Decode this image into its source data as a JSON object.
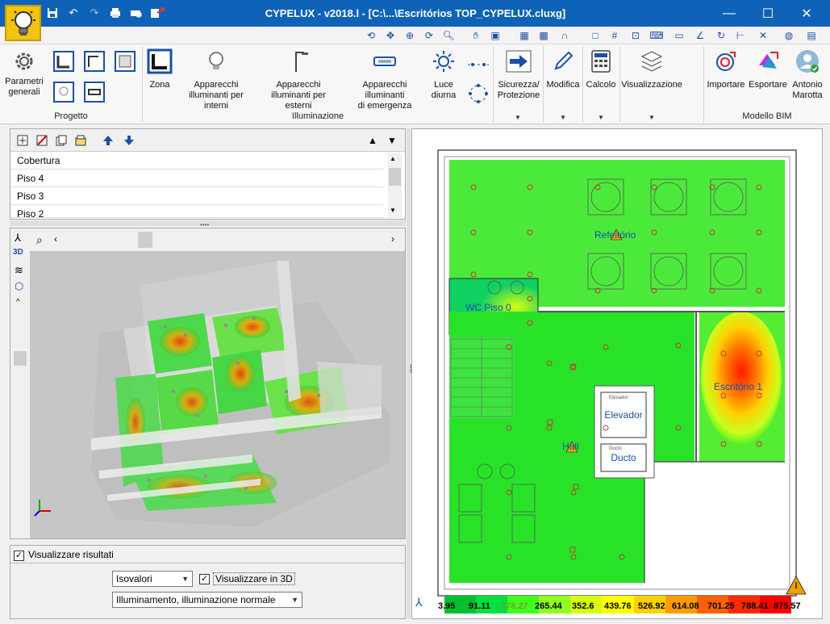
{
  "titlebar": {
    "title": "CYPELUX - v2018.l - [C:\\...\\Escritórios TOP_CYPELUX.cluxg]",
    "minimize": "—",
    "maximize": "☐",
    "close": "✕"
  },
  "ribbon": {
    "groups": {
      "progetto": "Progetto",
      "illuminazione": "Illuminazione",
      "modello_bim": "Modello BIM"
    },
    "buttons": {
      "parametri_l1": "Parametri",
      "parametri_l2": "generali",
      "zona": "Zona",
      "interni_l1": "Apparecchi",
      "interni_l2": "illuminanti per interni",
      "esterni_l1": "Apparecchi",
      "esterni_l2": "illuminanti per esterni",
      "emergenza_l1": "Apparecchi illuminanti",
      "emergenza_l2": "di emergenza",
      "luce_l1": "Luce",
      "luce_l2": "diurna",
      "sicurezza_l1": "Sicurezza/",
      "sicurezza_l2": "Protezione",
      "modifica": "Modifica",
      "calcolo": "Calcolo",
      "visualizzazione": "Visualizzazione",
      "importare": "Importare",
      "esportare": "Esportare",
      "user_l1": "Antonio",
      "user_l2": "Marotta"
    }
  },
  "floors": {
    "items": [
      "Cobertura",
      "Piso 4",
      "Piso 3",
      "Piso 2"
    ]
  },
  "bottom": {
    "show_results": "Visualizzare risultati",
    "isovalues": "Isovalori",
    "show3d": "Visualizzare in 3D",
    "illuminance": "Illuminamento, illuminazione normale"
  },
  "plan": {
    "rooms": {
      "refeitorio": "Refeitório",
      "wc": "WC Piso 0",
      "escritorio": "Escritório 1",
      "elevador": "Elevador",
      "elevador_small": "Elevador",
      "ducto": "Ducto",
      "ducto_small": "Ducto",
      "hall": "Hall"
    },
    "legend": [
      "3.95",
      "91.11",
      "178.27",
      "265.44",
      "352.6",
      "439.76",
      "526.92",
      "614.08",
      "701.25",
      "788.41",
      "875.57"
    ],
    "legend_colors": [
      "#00c030",
      "#00e040",
      "#40ff20",
      "#90ff20",
      "#d8ff10",
      "#ffff00",
      "#ffd000",
      "#ff9a00",
      "#ff6000",
      "#ff2a00",
      "#ff0000"
    ]
  },
  "colors": {
    "titlebar": "#0e63b8",
    "accent": "#1b4fa8"
  }
}
